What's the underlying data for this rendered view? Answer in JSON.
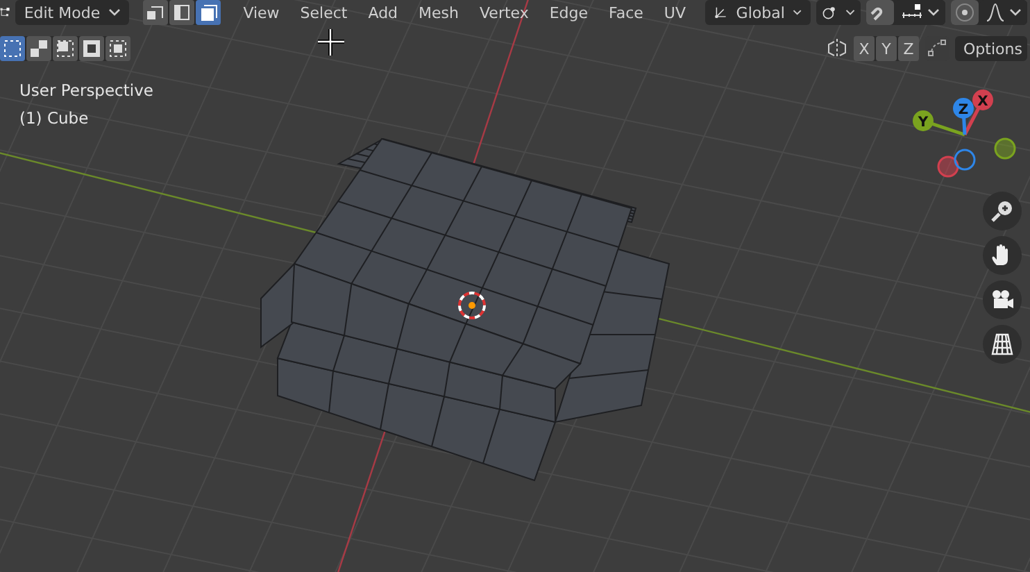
{
  "header": {
    "mode_dropdown": {
      "label": "Edit Mode"
    },
    "select_modes": [
      {
        "kind": "vertex",
        "selected": false
      },
      {
        "kind": "edge",
        "selected": false
      },
      {
        "kind": "face",
        "selected": true
      }
    ],
    "menus": [
      "View",
      "Select",
      "Add",
      "Mesh",
      "Vertex",
      "Edge",
      "Face",
      "UV"
    ],
    "orientation_dropdown": {
      "label": "Global"
    },
    "snapping": {
      "on": false
    },
    "proportional_editing": {
      "on": false
    }
  },
  "tool_settings": {
    "selection_tools": [
      {
        "kind": "box",
        "selected": true
      },
      {
        "kind": "extend",
        "selected": false
      },
      {
        "kind": "subtract",
        "selected": false
      },
      {
        "kind": "invert",
        "selected": false
      },
      {
        "kind": "intersect",
        "selected": false
      }
    ],
    "mirror_axes": [
      {
        "label": "X",
        "on": false
      },
      {
        "label": "Y",
        "on": false
      },
      {
        "label": "Z",
        "on": false
      }
    ],
    "options_dropdown": {
      "label": "Options"
    }
  },
  "viewport_info": [
    "User Perspective",
    "(1) Cube"
  ],
  "gizmo_axes": [
    {
      "label": "X",
      "color": "#d2404f"
    },
    {
      "label": "Y",
      "color": "#7aa31f"
    },
    {
      "label": "Z",
      "color": "#2e86e8"
    }
  ]
}
